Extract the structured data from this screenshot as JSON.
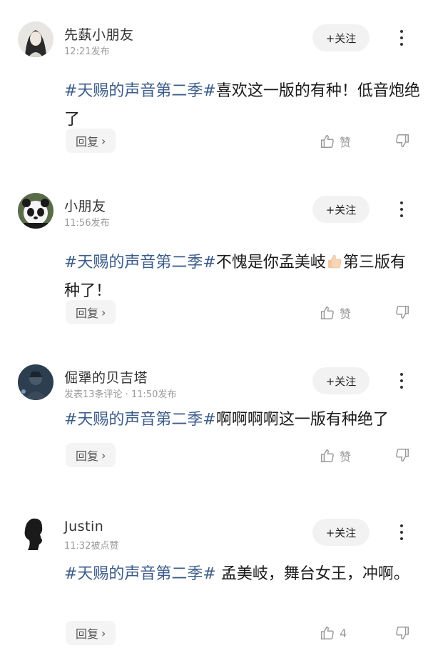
{
  "colors": {
    "tag": "#3d5d8a",
    "meta": "#9a9a9a",
    "button_bg": "#f2f2f2"
  },
  "posts": [
    {
      "author": "先蓺小朋友",
      "meta": "12:21发布",
      "follow_label": "+关注",
      "tag": "#天赐的声音第二季#",
      "text": "喜欢这一版的有种！低音炮绝了",
      "reply_label": "回复",
      "like_label": "赞",
      "avatar_icon": "girl-portrait-avatar"
    },
    {
      "author": "小朋友",
      "meta": "11:56发布",
      "follow_label": "+关注",
      "tag": "#天赐的声音第二季#",
      "text": "不愧是你孟美岐",
      "text_after": "第三版有种了！",
      "emoji": "thumbs-up-icon",
      "reply_label": "回复",
      "like_label": "赞",
      "avatar_icon": "panda-avatar"
    },
    {
      "author": "倔犟的贝吉塔",
      "meta": "发表13条评论 · 11:50发布",
      "follow_label": "+关注",
      "tag": "#天赐的声音第二季#",
      "text": "啊啊啊啊这一版有种绝了",
      "reply_label": "回复",
      "like_label": "赞",
      "avatar_icon": "dark-figure-avatar"
    },
    {
      "author": "Justin",
      "meta": "11:32被点赞",
      "follow_label": "+关注",
      "tag": "#天赐的声音第二季#",
      "text": " 孟美岐，舞台女王，冲啊。",
      "reply_label": "回复",
      "like_label": "4",
      "avatar_icon": "silhouette-avatar"
    }
  ]
}
